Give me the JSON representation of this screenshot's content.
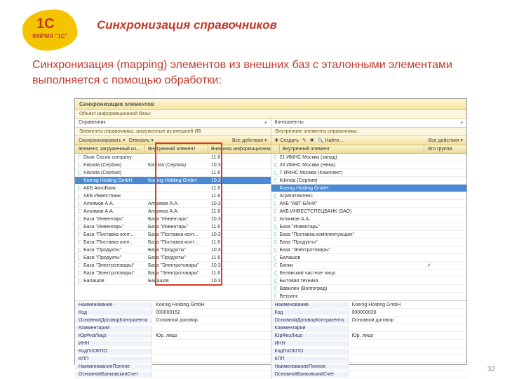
{
  "logo": {
    "big": "1C",
    "sub": "ФИРМА \"1C\""
  },
  "title": "Синхронизация справочников",
  "subtitle": "Синхронизация (mapping) элементов из внешних баз с эталонными элементами выполняется с помощью обработки:",
  "page_number": "32",
  "window": {
    "title": "Синхронизация элементов",
    "object_label": "Объект информационной базы:",
    "left_drop": "Справочник",
    "right_drop": "Контрагенты",
    "left_section": "Элементы справочника, загруженные из внешней ИБ",
    "right_section": "Внутренние элементы справочника:",
    "toolbar": {
      "sync": "Синхронизировать ▾",
      "unbind": "Отвязать ▾",
      "all": "Все действия ▾",
      "create": "Создать",
      "find": "Найти..."
    },
    "left_headers": [
      "Элемент, загруженный из...",
      "Внутренний элемент",
      "Внешняя информационна...",
      ""
    ],
    "right_headers": [
      "",
      "Внутренний элемент",
      "Это группа"
    ],
    "left_rows": [
      {
        "ext": "Divar Cacao company",
        "int": "",
        "ver": "11.6",
        "sel": false
      },
      {
        "ext": "Kikinda (Сербия)",
        "int": "Kikinda (Сербия)",
        "ver": "10.3",
        "sel": false
      },
      {
        "ext": "Kikinda (Сербия)",
        "int": "",
        "ver": "11.6",
        "sel": false
      },
      {
        "ext": "Koenig Holding GmbH",
        "int": "Koenig Holding GmbH",
        "ver": "10.3",
        "sel": true
      },
      {
        "ext": "АКБ АвтоБанк",
        "int": "",
        "ver": "11.6",
        "sel": false
      },
      {
        "ext": "АКБ Инвестбанк",
        "int": "",
        "ver": "11.6",
        "sel": false
      },
      {
        "ext": "Алхимов А.А.",
        "int": "Алхимов А.А.",
        "ver": "10.3",
        "sel": false
      },
      {
        "ext": "Алхимов А.А.",
        "int": "Алхимов А.А.",
        "ver": "11.6",
        "sel": false
      },
      {
        "ext": "База \"Инвентарь\"",
        "int": "База \"Инвентарь\"",
        "ver": "10.3",
        "sel": false
      },
      {
        "ext": "База \"Инвентарь\"",
        "int": "База \"Инвентарь\"",
        "ver": "11.6",
        "sel": false
      },
      {
        "ext": "База \"Поставка конт...",
        "int": "База \"Поставка конт...",
        "ver": "10.3",
        "sel": false
      },
      {
        "ext": "База \"Поставка конт...",
        "int": "База \"Поставка конт...",
        "ver": "11.6",
        "sel": false
      },
      {
        "ext": "База \"Продукты\"",
        "int": "База \"Продукты\"",
        "ver": "10.3",
        "sel": false
      },
      {
        "ext": "База \"Продукты\"",
        "int": "База \"Продукты\"",
        "ver": "11.6",
        "sel": false
      },
      {
        "ext": "База \"Электротовары\"",
        "int": "База \"Электротовары\"",
        "ver": "10.3",
        "sel": false
      },
      {
        "ext": "База \"Электротовары\"",
        "int": "База \"Электротовары\"",
        "ver": "11.6",
        "sel": false
      },
      {
        "ext": "Балашов",
        "int": "Балашов",
        "ver": "10.3",
        "sel": false
      }
    ],
    "right_rows": [
      {
        "name": "21 ИМНС Москва (запад)",
        "grp": "",
        "sel": false
      },
      {
        "name": "33 ИМНС Москва (Нева)",
        "grp": "",
        "sel": false
      },
      {
        "name": "7 ИМНС Москва (Комплект)",
        "grp": "",
        "sel": false
      },
      {
        "name": "Kikinda (Сербия)",
        "grp": "",
        "sel": false
      },
      {
        "name": "Koenig Holding GmbH",
        "grp": "",
        "sel": true
      },
      {
        "name": "Агрегатимпекс",
        "grp": "",
        "sel": false
      },
      {
        "name": "АКБ \"АВТ-БАНК\"",
        "grp": "",
        "sel": false
      },
      {
        "name": "АКБ ИНВЕСТСПЕЦБАНК (ЗАО)",
        "grp": "",
        "sel": false
      },
      {
        "name": "Алхимов А.А.",
        "grp": "",
        "sel": false
      },
      {
        "name": "База \"Инвентарь\"",
        "grp": "",
        "sel": false
      },
      {
        "name": "База \"Поставка комплектующих\"",
        "grp": "",
        "sel": false
      },
      {
        "name": "База \"Продукты\"",
        "grp": "",
        "sel": false
      },
      {
        "name": "База \"Электротовары\"",
        "grp": "",
        "sel": false
      },
      {
        "name": "Балашов",
        "grp": "",
        "sel": false
      },
      {
        "name": "Банки",
        "grp": "✓",
        "sel": false
      },
      {
        "name": "Белявский частное лицо",
        "grp": "",
        "sel": false
      },
      {
        "name": "Бытовая техника",
        "grp": "",
        "sel": false
      },
      {
        "name": "Вавилин (Волгоград)",
        "grp": "",
        "sel": false
      },
      {
        "name": "Ветранс",
        "grp": "",
        "sel": false
      }
    ],
    "form_left": [
      [
        "Наименование",
        "Koenig Holding GmbH"
      ],
      [
        "Код",
        "000000152"
      ],
      [
        "ОсновнойДоговорКонтрагента",
        "Основной договор"
      ],
      [
        "Комментарий",
        ""
      ],
      [
        "ЮрФизЛицо",
        "Юр. лицо"
      ],
      [
        "ИНН",
        ""
      ],
      [
        "КодПоОКПО",
        ""
      ],
      [
        "КПП",
        ""
      ],
      [
        "НаименованиеПолное",
        ""
      ],
      [
        "ОсновнойБанковскийСчет",
        ""
      ]
    ],
    "form_right": [
      [
        "Наименование",
        "Koenig Holding GmbH"
      ],
      [
        "Код",
        "000000026"
      ],
      [
        "ОсновнойДоговорКонтрагента",
        "Основной договор"
      ],
      [
        "Комментарий",
        ""
      ],
      [
        "ЮрФизЛицо",
        "Юр. лицо"
      ],
      [
        "ИНН",
        ""
      ],
      [
        "КодПоОКПО",
        ""
      ],
      [
        "КПП",
        ""
      ],
      [
        "НаименованиеПолное",
        ""
      ],
      [
        "ОсновнойБанковскийСчет",
        ""
      ]
    ]
  }
}
